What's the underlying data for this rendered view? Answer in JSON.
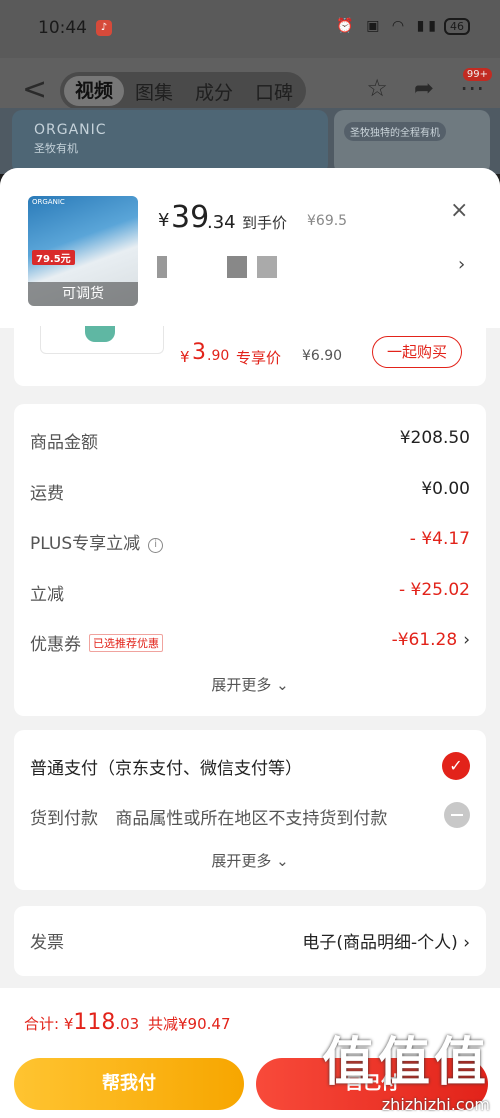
{
  "status_bar": {
    "time": "10:44",
    "battery": "46"
  },
  "nav": {
    "back": "<",
    "tabs": [
      "视频",
      "图集",
      "成分",
      "口碑"
    ],
    "active_tab": 0,
    "badge": "99+"
  },
  "banner": {
    "brand": "ORGANIC",
    "brand_cn": "圣牧有机",
    "right_text": "圣牧独特的全程有机"
  },
  "product": {
    "price_symbol": "¥",
    "price_int": "39",
    "price_dec": ".34",
    "price_label": "到手价",
    "original_price": "¥69.5",
    "image_brand": "ORGANIC",
    "image_tag": "79.5元",
    "image_caption": "可调货",
    "close": "×",
    "spec_arrow": "›"
  },
  "combo": {
    "price_symbol": "¥",
    "price_int": "3",
    "price_dec": ".90",
    "price_label": "专享价",
    "original_price": "¥6.90",
    "buy_button": "一起购买"
  },
  "fees": {
    "rows": [
      {
        "label": "商品金额",
        "value": "¥208.50"
      },
      {
        "label": "运费",
        "value": "¥0.00"
      },
      {
        "label": "PLUS专享立减",
        "value": "- ¥4.17"
      },
      {
        "label": "立减",
        "value": "- ¥25.02"
      },
      {
        "label": "优惠券",
        "value": "-¥61.28",
        "tag": "已选推荐优惠",
        "chevron": "›"
      }
    ],
    "expand": "展开更多 ⌄"
  },
  "payment": {
    "normal": "普通支付（京东支付、微信支付等）",
    "cod_label": "货到付款",
    "cod_note": "商品属性或所在地区不支持货到付款",
    "expand": "展开更多 ⌄"
  },
  "invoice": {
    "label": "发票",
    "value": "电子(商品明细-个人)",
    "chevron": "›"
  },
  "bottom": {
    "total_prefix": "合计: ¥",
    "total_int": "118",
    "total_dec": ".03",
    "saving": "共减¥90.47",
    "help_pay": "帮我付",
    "self_pay": "自己付"
  },
  "watermark": {
    "text": "值值值",
    "url": "zhizhizhi.com"
  },
  "colors": {
    "accent_red": "#e2231a",
    "accent_yellow": "#f7a600"
  }
}
